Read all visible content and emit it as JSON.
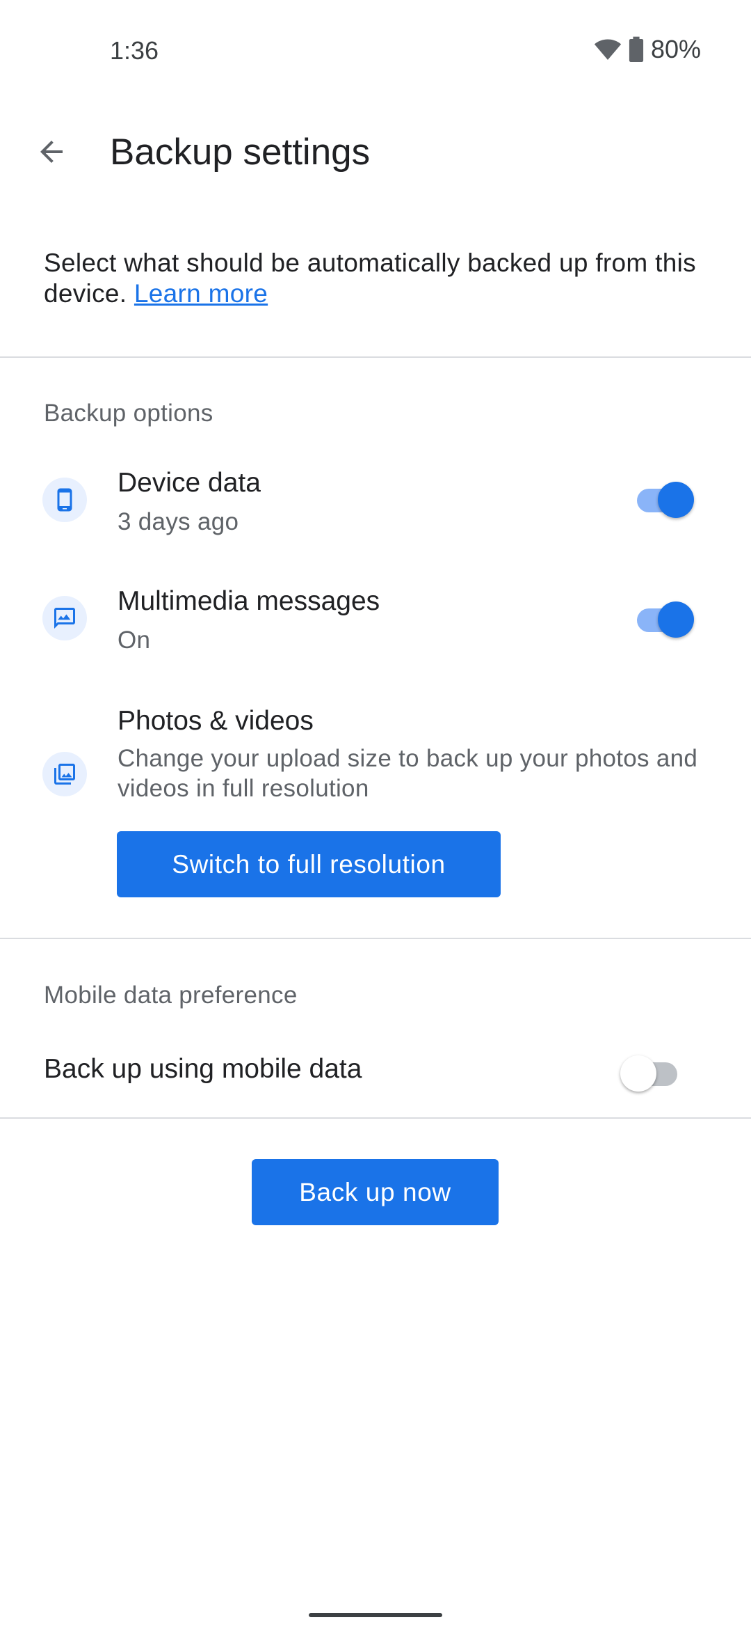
{
  "status_bar": {
    "time": "1:36",
    "battery_percent": "80%",
    "icons": [
      "wifi-icon",
      "battery-icon"
    ]
  },
  "app_bar": {
    "title": "Backup settings",
    "back_icon": "arrow-back-icon"
  },
  "intro": {
    "text": "Select what should be automatically backed up from this device. ",
    "link": "Learn more"
  },
  "backup_options": {
    "header": "Backup options",
    "items": [
      {
        "icon": "phone-icon",
        "title": "Device data",
        "subtitle": "3 days ago",
        "toggle": true
      },
      {
        "icon": "image-message-icon",
        "title": "Multimedia messages",
        "subtitle": "On",
        "toggle": true
      },
      {
        "icon": "photo-library-icon",
        "title": "Photos & videos",
        "subtitle": "Change your upload size to back up your photos and videos in full resolution"
      }
    ],
    "switch_button": "Switch to full resolution"
  },
  "mobile_data": {
    "header": "Mobile data preference",
    "label": "Back up using mobile data",
    "toggle": false
  },
  "back_up_now": "Back up now",
  "colors": {
    "accent": "#1a73e8",
    "accent_light": "#8ab4f8",
    "icon_bg": "#e8f0fe",
    "divider": "#dadce0",
    "secondary_text": "#5f6368"
  }
}
